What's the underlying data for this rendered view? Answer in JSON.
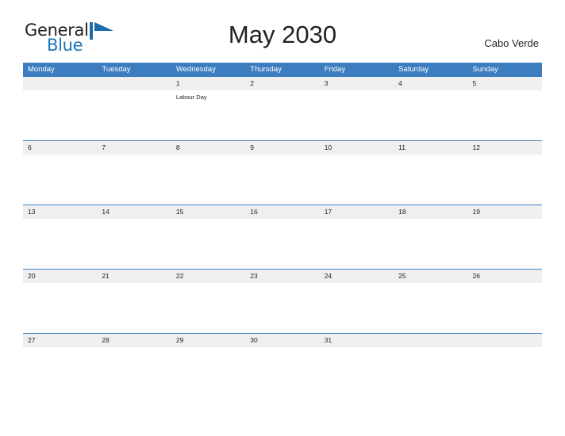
{
  "brand": {
    "name_part1": "General",
    "name_part2": "Blue",
    "flag_icon": "blue-flag-icon",
    "color_dark": "#231f20",
    "color_blue": "#1b75bb"
  },
  "header": {
    "title": "May 2030",
    "region": "Cabo Verde"
  },
  "theme": {
    "header_blue": "#3c7dbf",
    "row_band_gray": "#efefef",
    "text_dark": "#231f20"
  },
  "calendar": {
    "month": "May",
    "year": "2030",
    "weekday_headers": [
      "Monday",
      "Tuesday",
      "Wednesday",
      "Thursday",
      "Friday",
      "Saturday",
      "Sunday"
    ],
    "weeks": [
      [
        {
          "day": "",
          "event": ""
        },
        {
          "day": "",
          "event": ""
        },
        {
          "day": "1",
          "event": "Labour Day"
        },
        {
          "day": "2",
          "event": ""
        },
        {
          "day": "3",
          "event": ""
        },
        {
          "day": "4",
          "event": ""
        },
        {
          "day": "5",
          "event": ""
        }
      ],
      [
        {
          "day": "6",
          "event": ""
        },
        {
          "day": "7",
          "event": ""
        },
        {
          "day": "8",
          "event": ""
        },
        {
          "day": "9",
          "event": ""
        },
        {
          "day": "10",
          "event": ""
        },
        {
          "day": "11",
          "event": ""
        },
        {
          "day": "12",
          "event": ""
        }
      ],
      [
        {
          "day": "13",
          "event": ""
        },
        {
          "day": "14",
          "event": ""
        },
        {
          "day": "15",
          "event": ""
        },
        {
          "day": "16",
          "event": ""
        },
        {
          "day": "17",
          "event": ""
        },
        {
          "day": "18",
          "event": ""
        },
        {
          "day": "19",
          "event": ""
        }
      ],
      [
        {
          "day": "20",
          "event": ""
        },
        {
          "day": "21",
          "event": ""
        },
        {
          "day": "22",
          "event": ""
        },
        {
          "day": "23",
          "event": ""
        },
        {
          "day": "24",
          "event": ""
        },
        {
          "day": "25",
          "event": ""
        },
        {
          "day": "26",
          "event": ""
        }
      ],
      [
        {
          "day": "27",
          "event": ""
        },
        {
          "day": "28",
          "event": ""
        },
        {
          "day": "29",
          "event": ""
        },
        {
          "day": "30",
          "event": ""
        },
        {
          "day": "31",
          "event": ""
        },
        {
          "day": "",
          "event": ""
        },
        {
          "day": "",
          "event": ""
        }
      ]
    ]
  }
}
